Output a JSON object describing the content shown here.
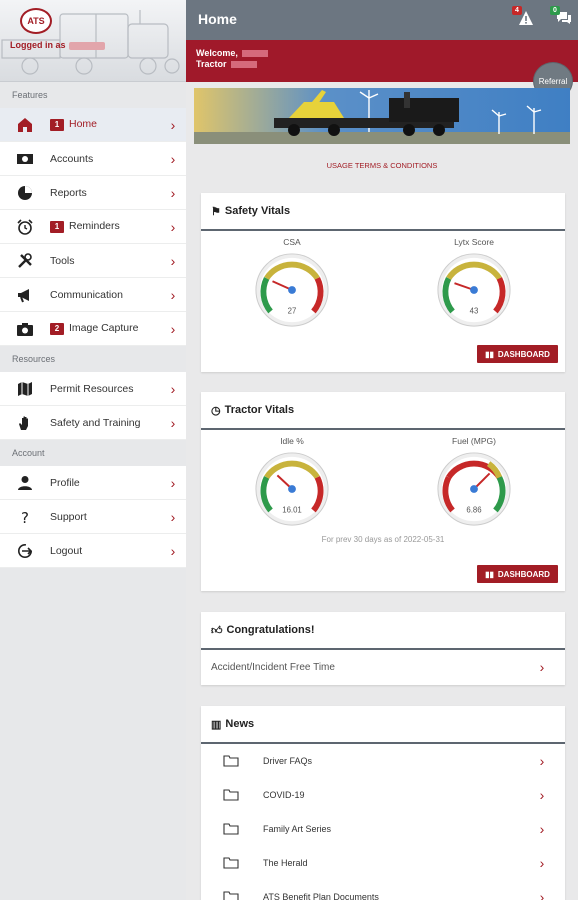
{
  "sidebar": {
    "logo_text": "ATS",
    "logged_in_label": "Logged in as",
    "sections": [
      {
        "title": "Features",
        "items": [
          {
            "label": "Home",
            "badge": "1",
            "icon": "home-icon",
            "active": true
          },
          {
            "label": "Accounts",
            "icon": "money-icon"
          },
          {
            "label": "Reports",
            "icon": "pie-chart-icon"
          },
          {
            "label": "Reminders",
            "badge": "1",
            "icon": "alarm-clock-icon"
          },
          {
            "label": "Tools",
            "icon": "tools-icon"
          },
          {
            "label": "Communication",
            "icon": "megaphone-icon"
          },
          {
            "label": "Image Capture",
            "badge": "2",
            "icon": "camera-icon"
          }
        ]
      },
      {
        "title": "Resources",
        "items": [
          {
            "label": "Permit Resources",
            "icon": "map-icon"
          },
          {
            "label": "Safety and Training",
            "icon": "hand-icon"
          }
        ]
      },
      {
        "title": "Account",
        "items": [
          {
            "label": "Profile",
            "icon": "person-icon"
          },
          {
            "label": "Support",
            "icon": "question-icon"
          },
          {
            "label": "Logout",
            "icon": "logout-icon"
          }
        ]
      }
    ]
  },
  "topbar": {
    "title": "Home",
    "alert_count": "4",
    "message_count": "0"
  },
  "welcome": {
    "welcome_label": "Welcome,",
    "tractor_label": "Tractor"
  },
  "referral_label": "Referral",
  "terms_link": "USAGE TERMS & CONDITIONS",
  "safety_vitals": {
    "title": "Safety Vitals",
    "gauges": [
      {
        "name": "CSA",
        "value": "27"
      },
      {
        "name": "Lytx Score",
        "value": "43"
      }
    ],
    "button": "DASHBOARD"
  },
  "tractor_vitals": {
    "title": "Tractor Vitals",
    "gauges": [
      {
        "name": "Idle %",
        "value": "16.01"
      },
      {
        "name": "Fuel (MPG)",
        "value": "6.86"
      }
    ],
    "note": "For prev 30 days as of 2022-05-31",
    "button": "DASHBOARD"
  },
  "congrats": {
    "title": "Congratulations!",
    "row": "Accident/Incident Free Time"
  },
  "news": {
    "title": "News",
    "items": [
      "Driver FAQs",
      "COVID-19",
      "Family Art Series",
      "The Herald",
      "ATS Benefit Plan Documents"
    ]
  },
  "colors": {
    "brand_red": "#a21d25",
    "topbar": "#6c7681",
    "gauge_green": "#2e9a4b",
    "gauge_yellow": "#c8b33c",
    "gauge_red": "#c62828"
  }
}
